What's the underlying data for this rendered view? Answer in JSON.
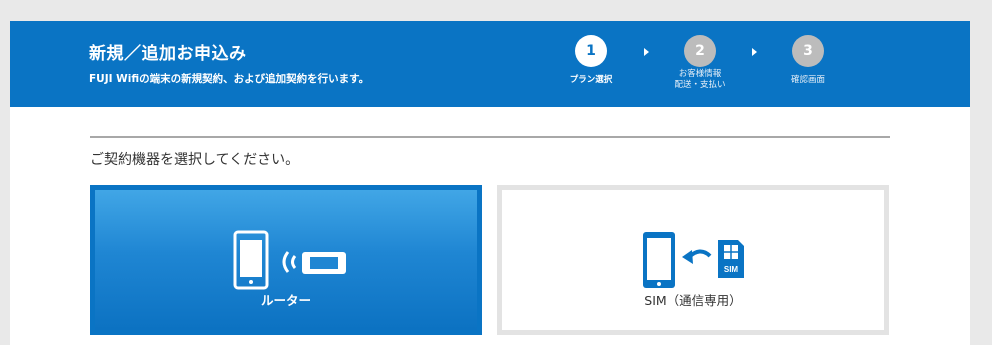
{
  "header": {
    "title": "新規／追加お申込み",
    "subtitle": "FUJI Wifiの端末の新規契約、および追加契約を行います。"
  },
  "steps": [
    {
      "number": "1",
      "label": "プラン選択",
      "active": true
    },
    {
      "number": "2",
      "label_line1": "お客様情報",
      "label_line2": "配送・支払い",
      "active": false
    },
    {
      "number": "3",
      "label": "確認画面",
      "active": false
    }
  ],
  "main": {
    "instruction": "ご契約機器を選択してください。",
    "options": [
      {
        "label": "ルーター",
        "icon": "router-device-icon",
        "selected": true
      },
      {
        "label": "SIM（通信専用）",
        "icon": "sim-card-icon",
        "selected": false
      }
    ]
  },
  "colors": {
    "brand": "#0a74c4",
    "inactive_step": "#bcbcbc",
    "background": "#e9e9e9"
  }
}
